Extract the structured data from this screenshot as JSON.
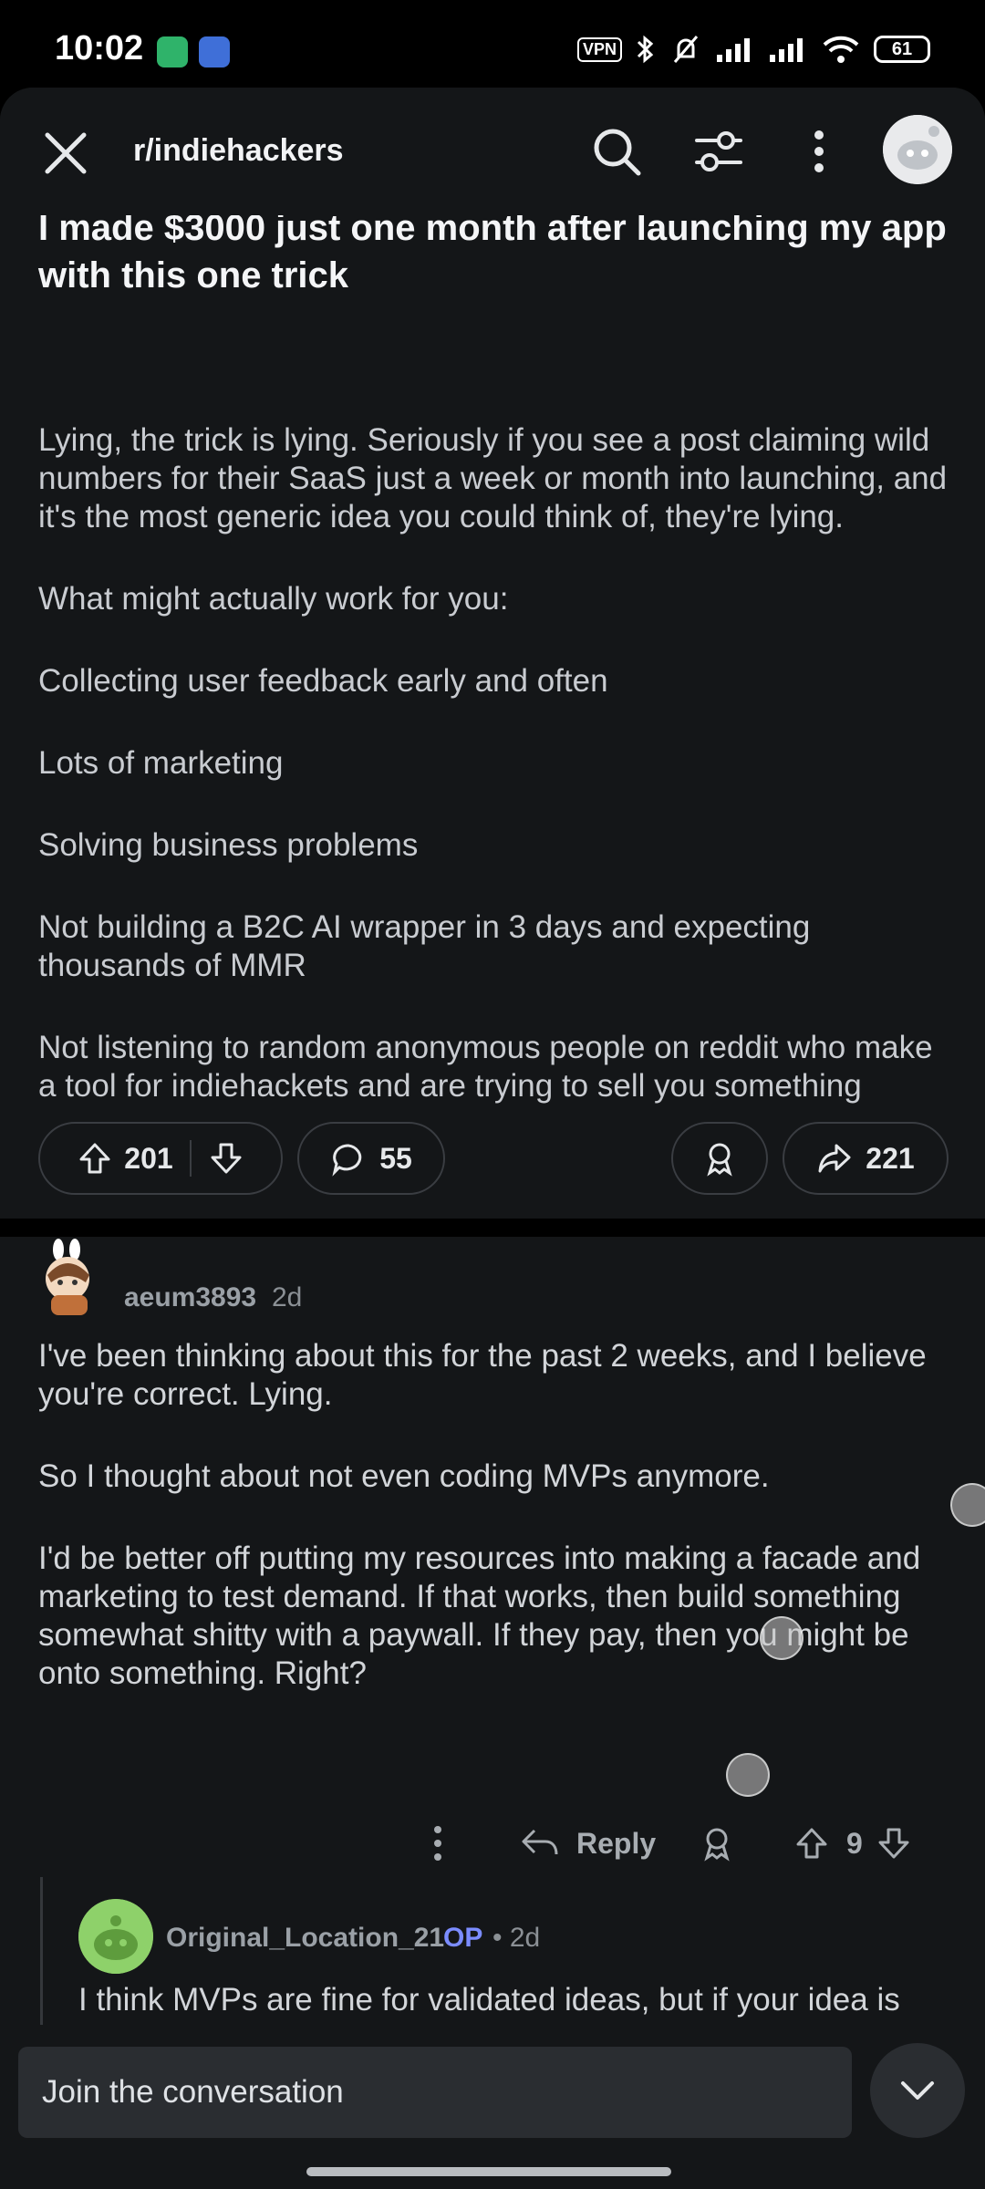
{
  "status_bar": {
    "time": "10:02",
    "vpn": "VPN",
    "battery": "61"
  },
  "topbar": {
    "subreddit": "r/indiehackers"
  },
  "post": {
    "title": "I made $3000 just one month after launching my app with this one trick",
    "paragraphs": [
      "Lying, the trick is lying. Seriously if you see a post claiming wild numbers for their SaaS just a week or month into launching, and it's the most generic idea you could think of, they're lying.",
      "What might actually work for you:",
      "Collecting user feedback early and often",
      "Lots of marketing",
      "Solving business problems",
      "Not building a B2C AI wrapper in 3 days and expecting thousands of MMR",
      "Not listening to random anonymous people on reddit who make a tool for indiehackets and are trying to sell you something"
    ],
    "upvotes": "201",
    "comments": "55",
    "shares": "221"
  },
  "comment": {
    "username": "aeum3893",
    "time": "2d",
    "paragraphs": [
      "I've been thinking about this for the past 2 weeks, and I believe you're correct. Lying.",
      "So I thought about not even coding MVPs anymore.",
      "I'd be better off putting my resources into making a facade and marketing to test demand. If that works, then build something somewhat shitty with a paywall. If they pay, then you might be onto something. Right?"
    ],
    "reply_label": "Reply",
    "votes": "9"
  },
  "reply": {
    "username": "Original_Location_21",
    "op_badge": "OP",
    "time": "• 2d",
    "body": "I think MVPs are fine for validated ideas, but if your idea is unvalidated using a landing page and capturing emails to test demand is a strategy many have used before to success"
  },
  "bottom": {
    "compose_placeholder": "Join the conversation"
  }
}
